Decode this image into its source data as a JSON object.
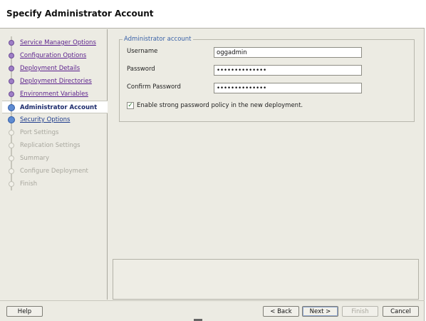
{
  "window": {
    "title": "Specify Administrator Account"
  },
  "steps": [
    {
      "label": "Service Manager Options",
      "state": "done"
    },
    {
      "label": "Configuration Options",
      "state": "done"
    },
    {
      "label": "Deployment Details",
      "state": "done"
    },
    {
      "label": "Deployment Directories",
      "state": "done"
    },
    {
      "label": "Environment Variables",
      "state": "done"
    },
    {
      "label": "Administrator Account",
      "state": "current"
    },
    {
      "label": "Security Options",
      "state": "next"
    },
    {
      "label": "Port Settings",
      "state": "disabled"
    },
    {
      "label": "Replication Settings",
      "state": "disabled"
    },
    {
      "label": "Summary",
      "state": "disabled"
    },
    {
      "label": "Configure Deployment",
      "state": "disabled"
    },
    {
      "label": "Finish",
      "state": "disabled"
    }
  ],
  "admin_account": {
    "legend": "Administrator account",
    "username_label": "Username",
    "username_value": "oggadmin",
    "password_label": "Password",
    "password_value": "••••••••••••••",
    "confirm_label": "Confirm Password",
    "confirm_value": "••••••••••••••",
    "strong_policy_label": "Enable strong password policy in the new deployment.",
    "strong_policy_checked": true,
    "check_mark": "✓"
  },
  "buttons": {
    "help": "Help",
    "back": "< Back",
    "next": "Next >",
    "finish": "Finish",
    "cancel": "Cancel"
  },
  "colors": {
    "done_link": "#5a1f8c",
    "current_step": "#1b2a6b",
    "legend": "#3a62a8",
    "window_bg": "#ecebe3"
  }
}
